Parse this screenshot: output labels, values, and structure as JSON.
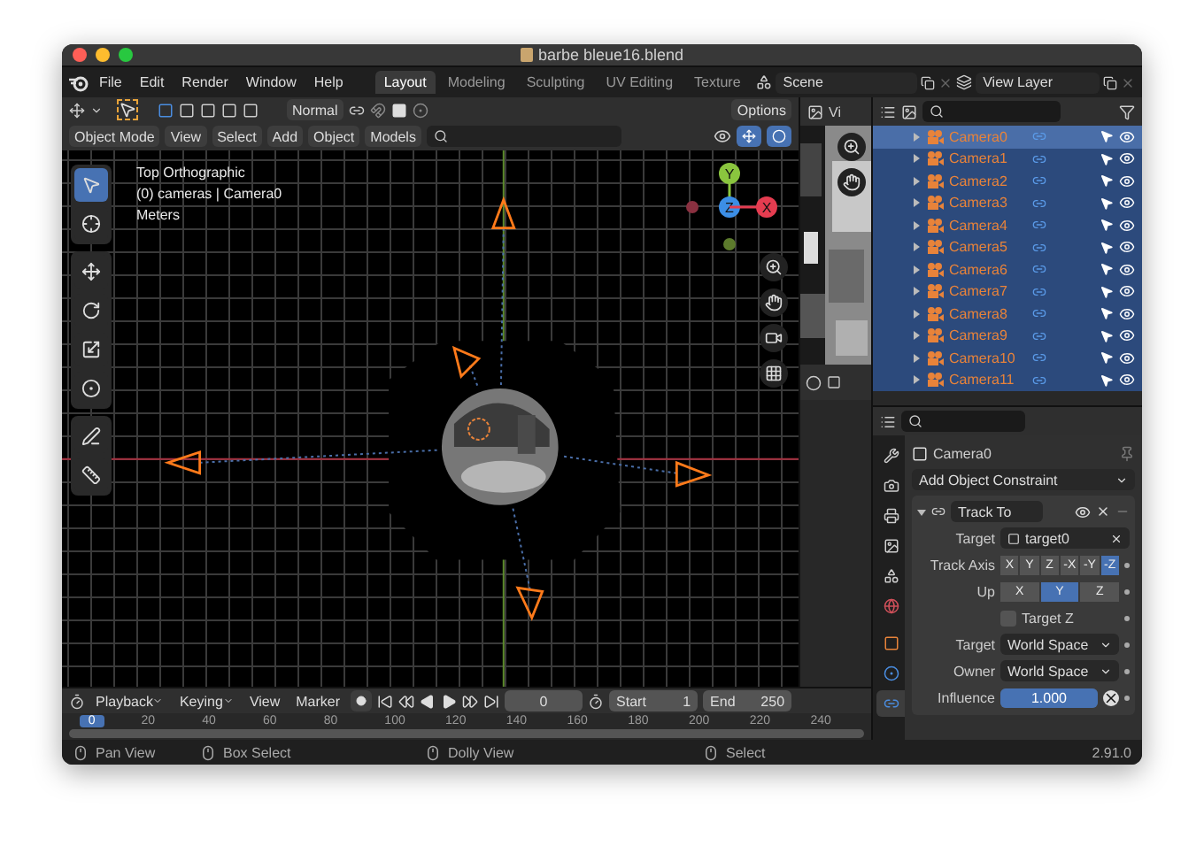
{
  "window": {
    "title": "barbe bleue16.blend"
  },
  "menu": [
    "File",
    "Edit",
    "Render",
    "Window",
    "Help"
  ],
  "workspaces": [
    {
      "label": "Layout",
      "selected": true
    },
    {
      "label": "Modeling",
      "selected": false
    },
    {
      "label": "Sculpting",
      "selected": false
    },
    {
      "label": "UV Editing",
      "selected": false
    },
    {
      "label": "Texture",
      "selected": false
    }
  ],
  "scene": "Scene",
  "view_layer": "View Layer",
  "tool_header": {
    "orientation": "Normal",
    "options": "Options"
  },
  "viewport_header": {
    "mode": "Object Mode",
    "menus": [
      "View",
      "Select",
      "Add",
      "Object"
    ],
    "collection": "Models"
  },
  "viewport": {
    "overlay_text": [
      "Top Orthographic",
      "(0) cameras | Camera0",
      "Meters"
    ],
    "tool_groups": [
      [
        {
          "kind": "select",
          "selected": true
        },
        {
          "kind": "cursor",
          "selected": false
        }
      ],
      [
        {
          "kind": "move",
          "selected": false
        },
        {
          "kind": "rotate",
          "selected": false
        },
        {
          "kind": "scale",
          "selected": false
        },
        {
          "kind": "transform",
          "selected": false
        }
      ],
      [
        {
          "kind": "annotate",
          "selected": false
        },
        {
          "kind": "measure",
          "selected": false
        }
      ]
    ],
    "gizmo_axes": [
      {
        "label": "Y",
        "color": "#8ac53e"
      },
      {
        "label": "Z",
        "color": "#3c8ee6"
      },
      {
        "label": "X",
        "color": "#e53c50"
      }
    ]
  },
  "image_editor": {
    "menu": "Vi"
  },
  "outliner": {
    "rows": [
      {
        "name": "Camera0",
        "selected": true,
        "active": true
      },
      {
        "name": "Camera1",
        "selected": true,
        "active": false
      },
      {
        "name": "Camera2",
        "selected": true,
        "active": false
      },
      {
        "name": "Camera3",
        "selected": true,
        "active": false
      },
      {
        "name": "Camera4",
        "selected": true,
        "active": false
      },
      {
        "name": "Camera5",
        "selected": true,
        "active": false
      },
      {
        "name": "Camera6",
        "selected": true,
        "active": false
      },
      {
        "name": "Camera7",
        "selected": true,
        "active": false
      },
      {
        "name": "Camera8",
        "selected": true,
        "active": false
      },
      {
        "name": "Camera9",
        "selected": true,
        "active": false
      },
      {
        "name": "Camera10",
        "selected": true,
        "active": false
      },
      {
        "name": "Camera11",
        "selected": true,
        "active": false
      }
    ]
  },
  "properties": {
    "tab_groups": [
      [
        {
          "kind": "tool",
          "selected": false
        },
        {
          "kind": "render",
          "selected": false
        },
        {
          "kind": "output",
          "selected": false
        },
        {
          "kind": "view_layer",
          "selected": false
        },
        {
          "kind": "scene",
          "selected": false
        },
        {
          "kind": "world",
          "selected": false
        }
      ],
      [
        {
          "kind": "object",
          "selected": false
        },
        {
          "kind": "physics",
          "selected": false
        },
        {
          "kind": "constraints",
          "selected": true
        }
      ]
    ],
    "object": "Camera0",
    "add_constraint": "Add Object Constraint",
    "constraint": {
      "name": "Track To",
      "expanded": true,
      "target_label": "Target",
      "target": "target0",
      "track_axis_label": "Track Axis",
      "track_axis": [
        {
          "label": "X",
          "selected": false
        },
        {
          "label": "Y",
          "selected": false
        },
        {
          "label": "Z",
          "selected": false
        },
        {
          "label": "-X",
          "selected": false
        },
        {
          "label": "-Y",
          "selected": false
        },
        {
          "label": "-Z",
          "selected": true
        }
      ],
      "up_label": "Up",
      "up": [
        {
          "label": "X",
          "selected": false
        },
        {
          "label": "Y",
          "selected": true
        },
        {
          "label": "Z",
          "selected": false
        }
      ],
      "target_z": {
        "label": "Target Z",
        "checked": false
      },
      "spaces": [
        {
          "label": "Target",
          "value": "World Space"
        },
        {
          "label": "Owner",
          "value": "World Space"
        }
      ],
      "influence": {
        "label": "Influence",
        "value": "1.000",
        "level": 1
      }
    }
  },
  "timeline": {
    "menus": [
      {
        "label": "Playback",
        "dropdown": true
      },
      {
        "label": "Keying",
        "dropdown": true
      },
      {
        "label": "View",
        "dropdown": false
      },
      {
        "label": "Marker",
        "dropdown": false
      }
    ],
    "current_frame": "0",
    "start_label": "Start",
    "start": "1",
    "end_label": "End",
    "end": "250",
    "ruler_current": "0",
    "ruler": [
      "20",
      "40",
      "60",
      "80",
      "100",
      "120",
      "140",
      "160",
      "180",
      "200",
      "220",
      "240"
    ]
  },
  "status_bar": {
    "hints": [
      "Pan View",
      "Box Select",
      "Dolly View",
      "Select"
    ],
    "version": "2.91.0"
  }
}
